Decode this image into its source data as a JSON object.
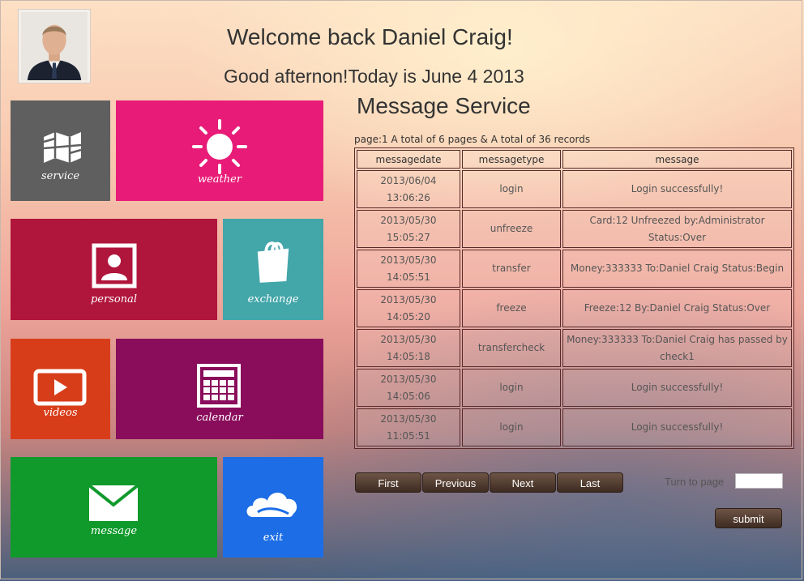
{
  "header": {
    "welcome": "Welcome back Daniel Craig!",
    "greeting": "Good afternon!Today is June 4 2013"
  },
  "tiles": {
    "service": {
      "label": "service",
      "color": "#5f5f5f"
    },
    "weather": {
      "label": "weather",
      "color": "#e81c78"
    },
    "personal": {
      "label": "personal",
      "color": "#b0153c"
    },
    "exchange": {
      "label": "exchange",
      "color": "#43a6a9"
    },
    "videos": {
      "label": "videos",
      "color": "#d83d1a"
    },
    "calendar": {
      "label": "calendar",
      "color": "#8a0d5c"
    },
    "message": {
      "label": "message",
      "color": "#0f9a2b"
    },
    "exit": {
      "label": "exit",
      "color": "#1d6ee6"
    }
  },
  "service": {
    "title": "Message Service",
    "page_info": "page:1   A total of 6 pages & A total of 36 records"
  },
  "table": {
    "columns": [
      "messagedate",
      "messagetype",
      "message"
    ],
    "rows": [
      {
        "date": "2013/06/04",
        "time": "13:06:26",
        "type": "login",
        "message": "Login successfully!"
      },
      {
        "date": "2013/05/30",
        "time": "15:05:27",
        "type": "unfreeze",
        "message": "Card:12 Unfreezed by:Administrator Status:Over"
      },
      {
        "date": "2013/05/30",
        "time": "14:05:51",
        "type": "transfer",
        "message": "Money:333333 To:Daniel Craig Status:Begin"
      },
      {
        "date": "2013/05/30",
        "time": "14:05:20",
        "type": "freeze",
        "message": "Freeze:12 By:Daniel Craig Status:Over"
      },
      {
        "date": "2013/05/30",
        "time": "14:05:18",
        "type": "transfercheck",
        "message": "Money:333333 To:Daniel Craig has passed by check1"
      },
      {
        "date": "2013/05/30",
        "time": "14:05:06",
        "type": "login",
        "message": "Login successfully!"
      },
      {
        "date": "2013/05/30",
        "time": "11:05:51",
        "type": "login",
        "message": "Login successfully!"
      }
    ]
  },
  "pager": {
    "first": "First",
    "previous": "Previous",
    "next": "Next",
    "last": "Last",
    "turn_label": "Turn to page",
    "turn_value": "",
    "submit": "submit"
  }
}
